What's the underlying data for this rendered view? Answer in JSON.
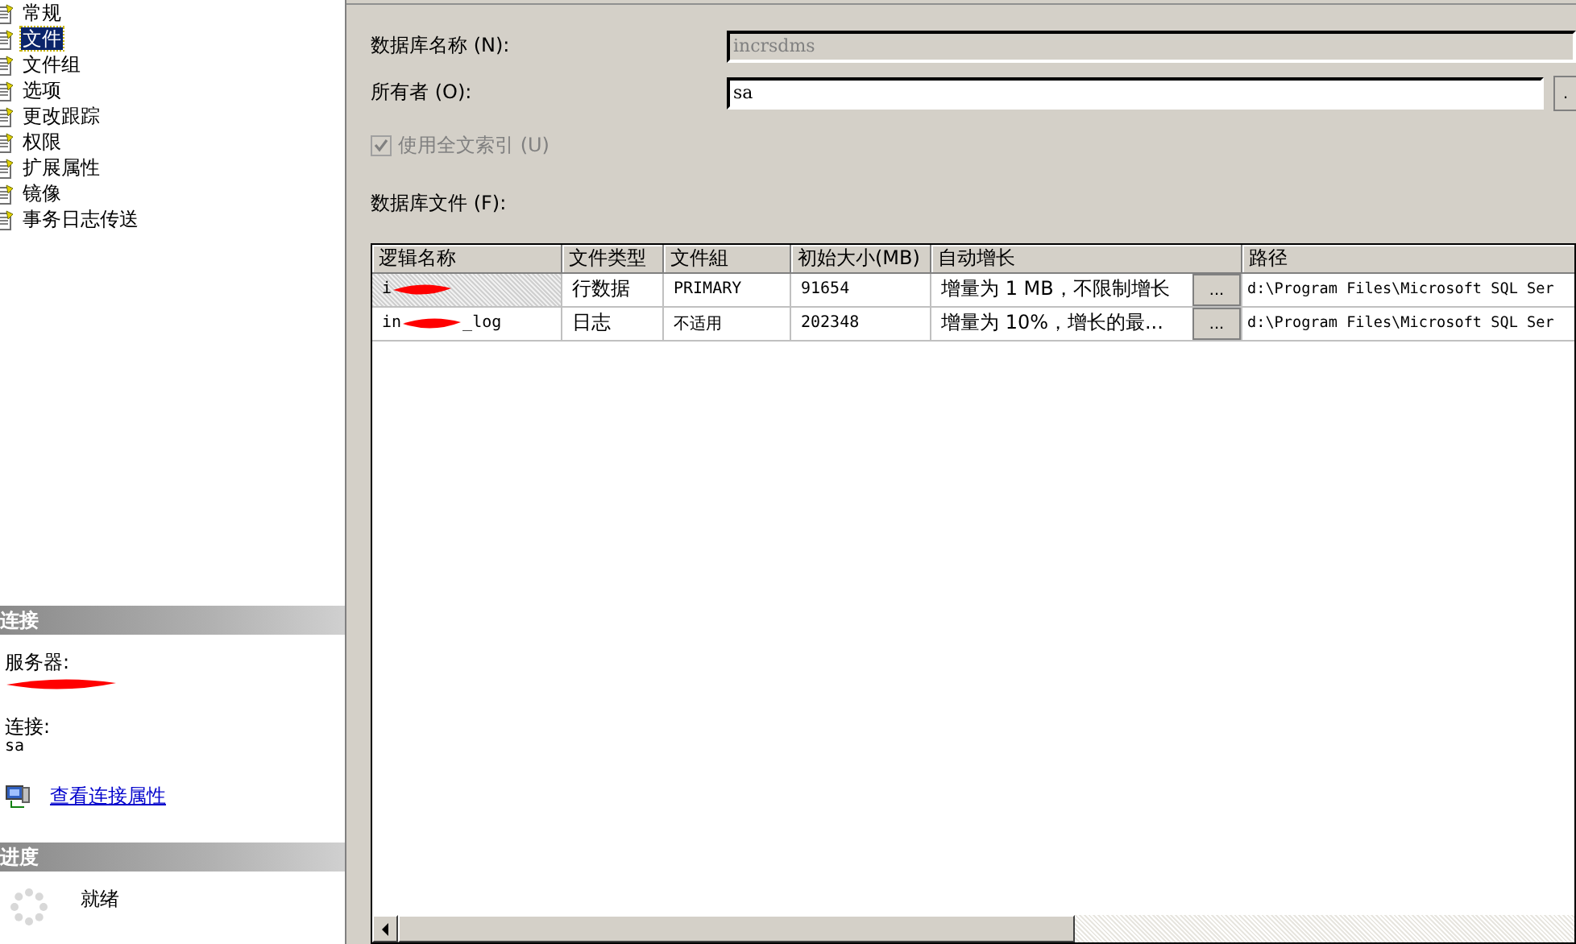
{
  "sidebar": {
    "pages": [
      {
        "label": "常规",
        "selected": false
      },
      {
        "label": "文件",
        "selected": true
      },
      {
        "label": "文件组",
        "selected": false
      },
      {
        "label": "选项",
        "selected": false
      },
      {
        "label": "更改跟踪",
        "selected": false
      },
      {
        "label": "权限",
        "selected": false
      },
      {
        "label": "扩展属性",
        "selected": false
      },
      {
        "label": "镜像",
        "selected": false
      },
      {
        "label": "事务日志传送",
        "selected": false
      }
    ],
    "connection": {
      "header": "连接",
      "server_label": "服务器:",
      "server_redacted": true,
      "connection_label": "连接:",
      "connection_value": "sa",
      "link": "查看连接属性"
    },
    "progress": {
      "header": "进度",
      "status": "就绪"
    }
  },
  "form": {
    "fields": [
      {
        "label": "数据库名称 (N):",
        "value": "incrsdms",
        "disabled": true
      },
      {
        "label": "所有者 (O):",
        "value": "sa",
        "disabled": false,
        "browse_button": "."
      }
    ],
    "fulltext": {
      "label": "使用全文索引 (U)",
      "checked": true,
      "disabled": true
    },
    "files_label": "数据库文件 (F):"
  },
  "table": {
    "columns": [
      "逻辑名称",
      "文件类型",
      "文件組",
      "初始大小(MB)",
      "自动增长",
      "路径"
    ],
    "rows": [
      {
        "name_prefix": "i",
        "redacted": true,
        "type": "行数据",
        "filegroup": "PRIMARY",
        "size": "91654",
        "growth": "增量为 1 MB，不限制增长",
        "growth_button": "...",
        "path": "d:\\Program Files\\Microsoft SQL Ser",
        "selected": true
      },
      {
        "name_prefix": "in",
        "name_suffix": "_log",
        "redacted": true,
        "type": "日志",
        "filegroup": "不适用",
        "size": "202348",
        "growth": "增量为 10%，增长的最...",
        "growth_button": "...",
        "path": "d:\\Program Files\\Microsoft SQL Ser",
        "selected": false
      }
    ]
  }
}
